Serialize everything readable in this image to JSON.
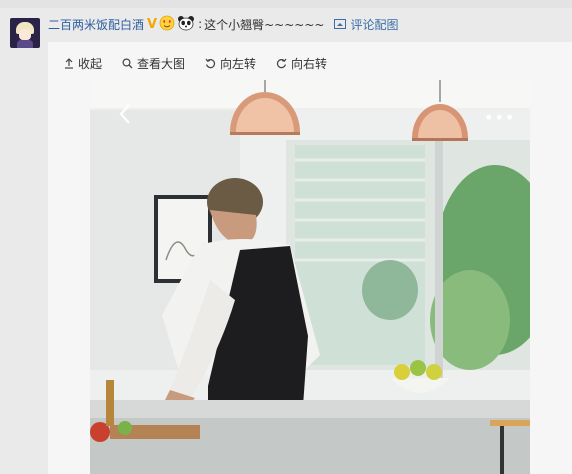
{
  "comment": {
    "username": "二百两米饭配白酒",
    "verified_badge": "V",
    "emojis": [
      "love-face",
      "panda-face"
    ],
    "text": "这个小翘臀~~~~~~",
    "image_link_label": "评论配图"
  },
  "toolbar": {
    "collapse_label": "收起",
    "view_large_label": "查看大图",
    "rotate_left_label": "向左转",
    "rotate_right_label": "向右转"
  },
  "photo": {
    "more_label": "•••"
  },
  "colors": {
    "link": "#3b6ea8",
    "badge": "#f7a600",
    "page_bg": "#eaeaea",
    "panel_bg": "#f6f6f6"
  }
}
